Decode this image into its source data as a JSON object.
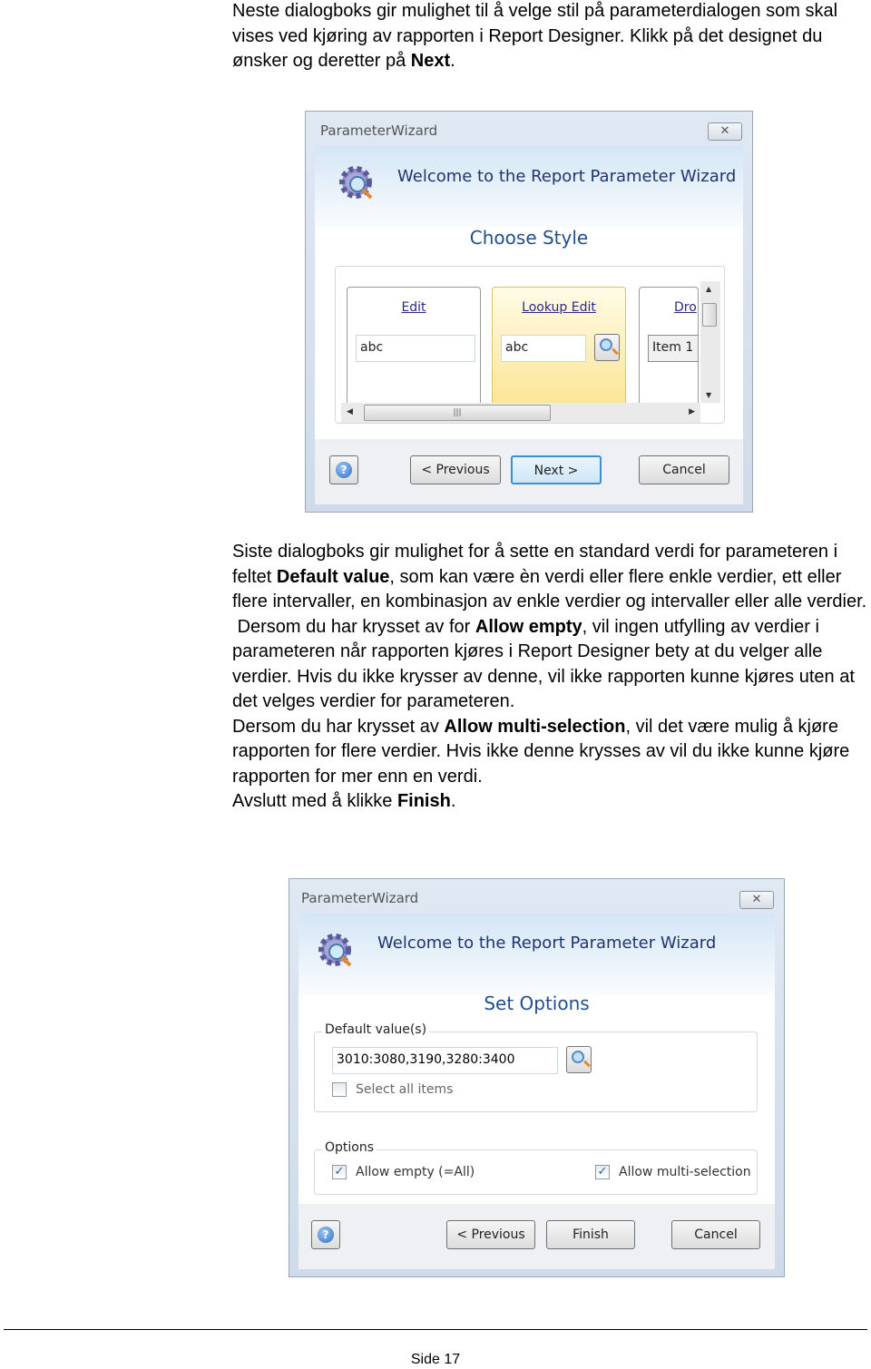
{
  "intro": {
    "t1": "Neste dialogboks gir mulighet til å velge stil på parameterdialogen som skal vises ved kjøring av rapporten i Report Designer. Klikk på det designet du ønsker og deretter på ",
    "b1": "Next",
    "t2": "."
  },
  "dialog1": {
    "title": "ParameterWizard",
    "close": "✕",
    "welcome": "Welcome to the Report Parameter Wizard",
    "step": "Choose Style",
    "cards": [
      {
        "label": "Edit",
        "value": "abc"
      },
      {
        "label": "Lookup Edit",
        "value": "abc"
      },
      {
        "label": "Dro",
        "value": "Item 1"
      }
    ],
    "help": "?",
    "previous": "< Previous",
    "next": "Next >",
    "cancel": "Cancel"
  },
  "body": {
    "p1a": "Siste dialogboks gir mulighet for å sette en standard verdi for parameteren i feltet ",
    "p1b": "Default value",
    "p1c": ", som kan være èn verdi eller flere enkle verdier, ett eller flere intervaller, en kombinasjon av enkle verdier og intervaller eller alle verdier.",
    "p2a": " Dersom du har krysset av for ",
    "p2b": "Allow empty",
    "p2c": ", vil ingen utfylling av verdier i parameteren når rapporten kjøres i Report Designer bety at du velger alle verdier. Hvis du ikke krysser av denne, vil ikke rapporten kunne kjøres uten at det velges verdier for parameteren.",
    "p3a": "Dersom du har krysset av ",
    "p3b": "Allow multi-selection",
    "p3c": ", vil det være mulig å kjøre rapporten for flere verdier. Hvis ikke denne krysses av vil du ikke kunne kjøre rapporten for mer enn en verdi.",
    "p4a": "Avslutt med å klikke ",
    "p4b": "Finish",
    "p4c": "."
  },
  "dialog2": {
    "title": "ParameterWizard",
    "close": "✕",
    "welcome": "Welcome to the Report Parameter Wizard",
    "step": "Set Options",
    "default_group": "Default value(s)",
    "default_value": "3010:3080,3190,3280:3400",
    "select_all": {
      "label": "Select all items",
      "checked": false
    },
    "options_group": "Options",
    "allow_empty": {
      "label": "Allow empty (=All)",
      "checked": true
    },
    "allow_multi": {
      "label": "Allow multi-selection",
      "checked": true
    },
    "help": "?",
    "previous": "< Previous",
    "finish": "Finish",
    "cancel": "Cancel"
  },
  "footer": {
    "page": "Side 17"
  }
}
